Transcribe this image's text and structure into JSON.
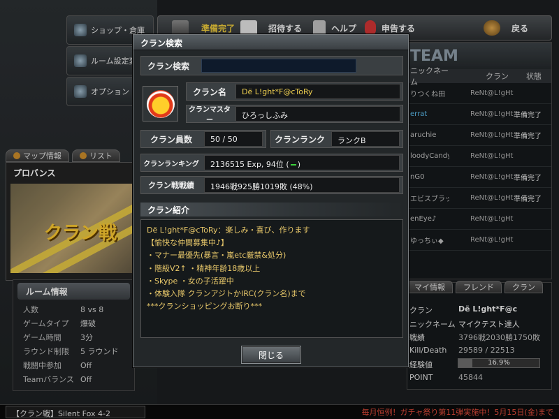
{
  "left_menu": [
    {
      "label": "ショップ・倉庫",
      "icon": "shop-icon"
    },
    {
      "label": "ルーム設定変更",
      "icon": "gear-icon"
    },
    {
      "label": "オプション",
      "icon": "option-icon"
    }
  ],
  "top_bar": {
    "ready": "準備完了",
    "invite": "招待する",
    "help": "ヘルプ",
    "report": "申告する",
    "back": "戻る"
  },
  "map_tabs": [
    "マップ情報",
    "リスト"
  ],
  "map": {
    "name": "プロバンス",
    "banner": "クラン戦"
  },
  "room_info": {
    "title": "ルーム情報",
    "rows": [
      {
        "k": "人数",
        "v": "8 vs 8"
      },
      {
        "k": "ゲームタイプ",
        "v": "爆破"
      },
      {
        "k": "ゲーム時間",
        "v": "3分"
      },
      {
        "k": "ラウンド制限",
        "v": "5 ラウンド"
      },
      {
        "k": "戦闘中参加",
        "v": "Off"
      },
      {
        "k": "Teamバランス",
        "v": "Off"
      }
    ]
  },
  "team": {
    "title": "TEAM",
    "cols": [
      "ニックネーム",
      "クラン",
      "状態"
    ],
    "rows": [
      {
        "name": "りつくね田",
        "clan": "ReNt@L!gHt",
        "state": ""
      },
      {
        "name": "errat",
        "clan": "ReNt@L!gHt",
        "state": "準備完了"
      },
      {
        "name": "aruchie",
        "clan": "ReNt@L!gHt",
        "state": "準備完了"
      },
      {
        "name": "loodyCandy",
        "clan": "ReNt@L!gHt",
        "state": ""
      },
      {
        "name": "nG0",
        "clan": "ReNt@L!gHt",
        "state": "準備完了"
      },
      {
        "name": "エビスブラック",
        "clan": "ReNt@L!gHt",
        "state": "準備完了"
      },
      {
        "name": "enEye♪",
        "clan": "ReNt@L!gHt",
        "state": ""
      },
      {
        "name": "ゆっちぃ◆",
        "clan": "ReNt@L!gHt",
        "state": ""
      }
    ]
  },
  "my_tabs": [
    "マイ情報",
    "フレンド",
    "クラン"
  ],
  "my_info": [
    {
      "k": "クラン",
      "v": "Dё L!ght*F@c"
    },
    {
      "k": "ニックネーム",
      "v": "マイクテスト達人"
    },
    {
      "k": "戦績",
      "v": "3796戦2030勝1750敗"
    },
    {
      "k": "Kill/Death",
      "v": "29589 / 22513"
    },
    {
      "k": "経験値",
      "v": "16.9%"
    },
    {
      "k": "POINT",
      "v": "45844"
    }
  ],
  "exp_fill": 0.169,
  "bottom": {
    "room": "【クラン戦】Silent Fox 4-2",
    "ticker": "毎月恒例！ガチャ祭り第11弾実施中！5月15日(金)まで"
  },
  "dialog": {
    "title": "クラン検索",
    "search_label": "クラン検索",
    "search_value": "",
    "clan_name_label": "クラン名",
    "clan_name": "Dё L!ght*F@cToRy",
    "master_label": "クランマスター",
    "master": "ひろっしふみ",
    "members_label": "クラン員数",
    "members": "50 / 50",
    "rank_label": "クランランク",
    "rank": "ランクB",
    "ranking_label": "クランランキング",
    "ranking_pre": "2136515 Exp, 94位 (",
    "ranking_post": ")",
    "record_label": "クラン戦戦績",
    "record": "1946戦925勝1019敗 (48%)",
    "intro_title": "クラン紹介",
    "intro_lines": [
      "Dё L!ght*F@cToRy：楽しみ・喜び、作ります",
      "【愉快な仲間募集中♪】",
      "・マナー最優先(暴言・嵐etc厳禁&処分)",
      "・階級V2↑  ・精神年齢18歳以上",
      "・Skype ・女の子活躍中",
      "・体験入隊 クランアジトかIRC(クラン名)まで",
      "***クランショッピングお断り***"
    ],
    "close": "閉じる"
  }
}
